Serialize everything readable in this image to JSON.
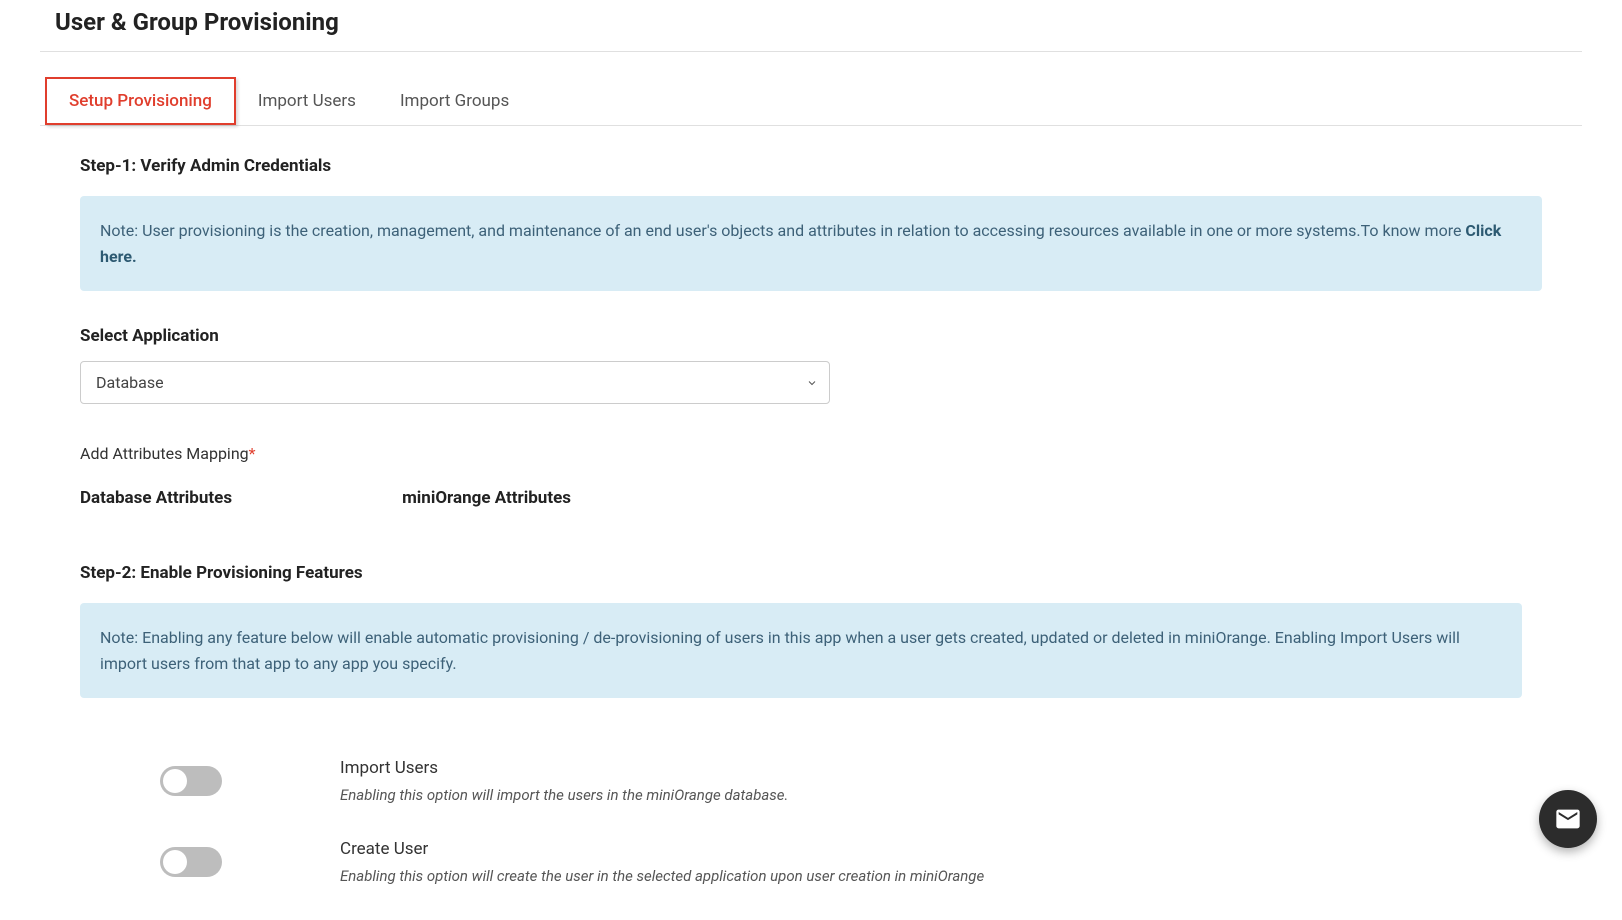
{
  "page": {
    "title": "User & Group Provisioning"
  },
  "tabs": {
    "setup": "Setup Provisioning",
    "importUsers": "Import Users",
    "importGroups": "Import Groups"
  },
  "step1": {
    "title": "Step-1: Verify Admin Credentials",
    "noteText": "Note: User provisioning is the creation, management, and maintenance of an end user's objects and attributes in relation to accessing resources available in one or more systems.To know more ",
    "noteLink": "Click here."
  },
  "selectApp": {
    "label": "Select Application",
    "value": "Database"
  },
  "attrMapping": {
    "label": "Add Attributes Mapping",
    "col1": "Database Attributes",
    "col2": "miniOrange Attributes"
  },
  "step2": {
    "title": "Step-2: Enable Provisioning Features",
    "noteText": "Note: Enabling any feature below will enable automatic provisioning / de-provisioning of users in this app when a user gets created, updated or deleted in miniOrange. Enabling Import Users will import users from that app to any app you specify."
  },
  "features": {
    "importUsers": {
      "title": "Import Users",
      "desc": "Enabling this option will import the users in the miniOrange database."
    },
    "createUser": {
      "title": "Create User",
      "desc": "Enabling this option will create the user in the selected application upon user creation in miniOrange"
    }
  }
}
